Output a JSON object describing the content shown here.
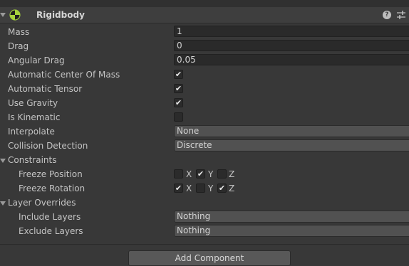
{
  "component": {
    "title": "Rigidbody",
    "help_glyph": "?",
    "icon": "rigidbody-icon",
    "settings_icon": "presets-sliders-icon"
  },
  "fields": {
    "mass": {
      "label": "Mass",
      "value": "1"
    },
    "drag": {
      "label": "Drag",
      "value": "0"
    },
    "angular_drag": {
      "label": "Angular Drag",
      "value": "0.05"
    },
    "auto_center_of_mass": {
      "label": "Automatic Center Of Mass",
      "checked": true
    },
    "auto_tensor": {
      "label": "Automatic Tensor",
      "checked": true
    },
    "use_gravity": {
      "label": "Use Gravity",
      "checked": true
    },
    "is_kinematic": {
      "label": "Is Kinematic",
      "checked": false
    },
    "interpolate": {
      "label": "Interpolate",
      "value": "None"
    },
    "collision_detection": {
      "label": "Collision Detection",
      "value": "Discrete"
    }
  },
  "constraints": {
    "label": "Constraints",
    "freeze_position": {
      "label": "Freeze Position",
      "x": false,
      "y": true,
      "z": false
    },
    "freeze_rotation": {
      "label": "Freeze Rotation",
      "x": true,
      "y": false,
      "z": true
    },
    "axis_labels": {
      "x": "X",
      "y": "Y",
      "z": "Z"
    }
  },
  "layer_overrides": {
    "label": "Layer Overrides",
    "include_layers": {
      "label": "Include Layers",
      "value": "Nothing"
    },
    "exclude_layers": {
      "label": "Exclude Layers",
      "value": "Nothing"
    }
  },
  "add_component": {
    "label": "Add Component"
  },
  "check_glyph": "✔",
  "colors": {
    "background": "#383838",
    "header": "#3e3e3e",
    "field": "#2a2a2a",
    "dropdown": "#515151",
    "text": "#c4c4c4"
  }
}
